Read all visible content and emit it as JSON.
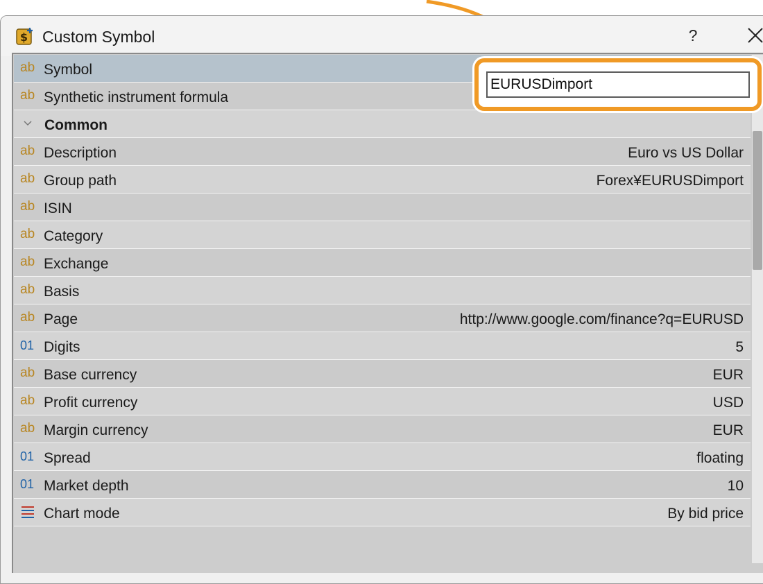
{
  "window": {
    "title": "Custom Symbol",
    "help_label": "?",
    "icons": {
      "app": "dollar-document-icon",
      "close": "close-icon"
    }
  },
  "symbol_input": {
    "value": "EURUSDimport"
  },
  "accent": {
    "highlight": "#f09a26",
    "selected_row": "#b5c2cc",
    "string_icon": "#b88622",
    "number_icon": "#1f62a6"
  },
  "rows": [
    {
      "type": "string",
      "icon_text": "ab",
      "label": "Symbol",
      "value": ""
    },
    {
      "type": "string",
      "icon_text": "ab",
      "label": "Synthetic instrument formula",
      "value": ""
    },
    {
      "type": "group",
      "label": "Common"
    },
    {
      "type": "string",
      "icon_text": "ab",
      "label": "Description",
      "value": "Euro vs US Dollar"
    },
    {
      "type": "string",
      "icon_text": "ab",
      "label": "Group path",
      "value": "Forex¥EURUSDimport"
    },
    {
      "type": "string",
      "icon_text": "ab",
      "label": "ISIN",
      "value": ""
    },
    {
      "type": "string",
      "icon_text": "ab",
      "label": "Category",
      "value": ""
    },
    {
      "type": "string",
      "icon_text": "ab",
      "label": "Exchange",
      "value": ""
    },
    {
      "type": "string",
      "icon_text": "ab",
      "label": "Basis",
      "value": ""
    },
    {
      "type": "string",
      "icon_text": "ab",
      "label": "Page",
      "value": "http://www.google.com/finance?q=EURUSD"
    },
    {
      "type": "number",
      "icon_text": "01",
      "label": "Digits",
      "value": "5"
    },
    {
      "type": "string",
      "icon_text": "ab",
      "label": "Base currency",
      "value": "EUR"
    },
    {
      "type": "string",
      "icon_text": "ab",
      "label": "Profit currency",
      "value": "USD"
    },
    {
      "type": "string",
      "icon_text": "ab",
      "label": "Margin currency",
      "value": "EUR"
    },
    {
      "type": "number",
      "icon_text": "01",
      "label": "Spread",
      "value": "floating"
    },
    {
      "type": "number",
      "icon_text": "01",
      "label": "Market depth",
      "value": "10"
    },
    {
      "type": "enum",
      "icon_text": "",
      "label": "Chart mode",
      "value": "By bid price"
    }
  ]
}
